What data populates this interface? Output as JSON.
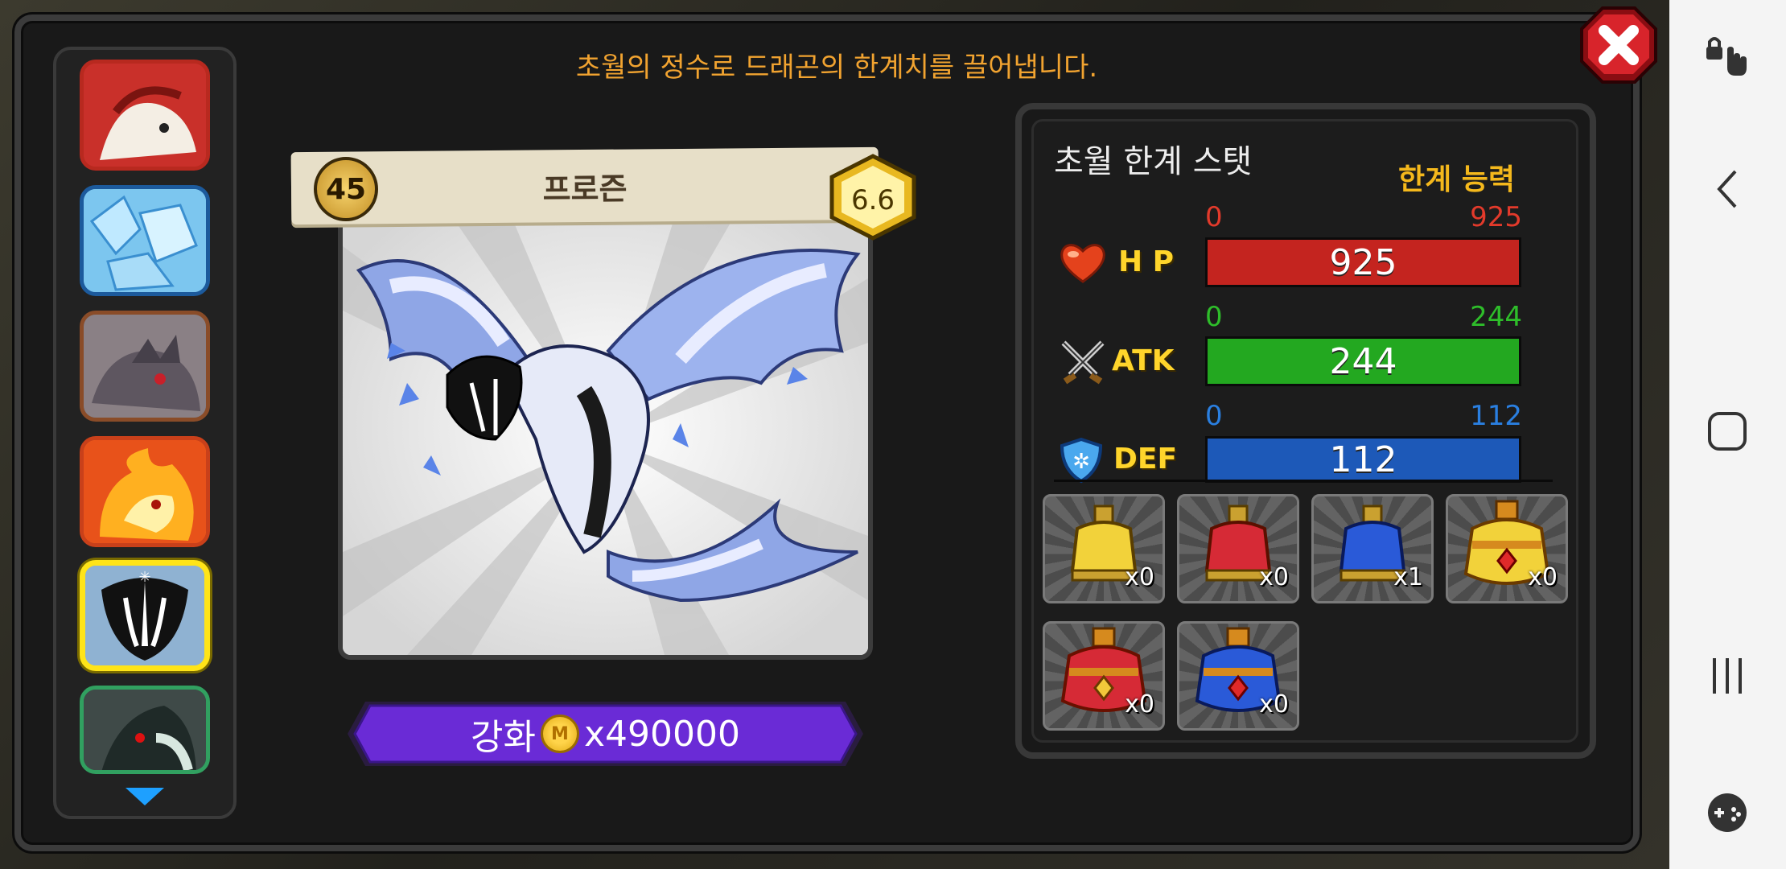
{
  "screen": {
    "title": "초월의 정수로 드래곤의 한계치를 끌어냅니다."
  },
  "dragon": {
    "level": "45",
    "name": "프로즌",
    "grade": "6.6"
  },
  "enhance": {
    "label": "강화",
    "coin_icon_text": "M",
    "cost": "x490000"
  },
  "stats": {
    "panel_title": "초월 한계 스탯",
    "limit_label": "한계 능력",
    "rows": [
      {
        "label": "H P",
        "icon": "heart-icon",
        "min": "0",
        "max": "925",
        "value": "925",
        "fraction": 1.0,
        "color": "#c4241f",
        "num_color": "#e23a2b"
      },
      {
        "label": "ATK",
        "icon": "swords-icon",
        "min": "0",
        "max": "244",
        "value": "244",
        "fraction": 1.0,
        "color": "#23a820",
        "num_color": "#2ebd2a"
      },
      {
        "label": "DEF",
        "icon": "shield-icon",
        "min": "0",
        "max": "112",
        "value": "112",
        "fraction": 1.0,
        "color": "#1d59b8",
        "num_color": "#2a7fe0"
      }
    ]
  },
  "items": [
    {
      "name": "yellow-potion-small",
      "count": "x0"
    },
    {
      "name": "red-potion-small",
      "count": "x0"
    },
    {
      "name": "blue-potion-small",
      "count": "x1"
    },
    {
      "name": "yellow-potion-large",
      "count": "x0"
    },
    {
      "name": "red-potion-large",
      "count": "x0"
    },
    {
      "name": "blue-potion-large",
      "count": "x0"
    }
  ],
  "sidebar": {
    "dragons": [
      {
        "name": "red-white-dragon",
        "element": "fire"
      },
      {
        "name": "ice-crystal-dragon",
        "element": "ice"
      },
      {
        "name": "gray-rock-dragon",
        "element": "earth"
      },
      {
        "name": "flame-dragon",
        "element": "fire"
      },
      {
        "name": "frozen-dragon",
        "element": "ice",
        "selected": true
      },
      {
        "name": "dark-green-dragon",
        "element": "dark"
      }
    ]
  }
}
